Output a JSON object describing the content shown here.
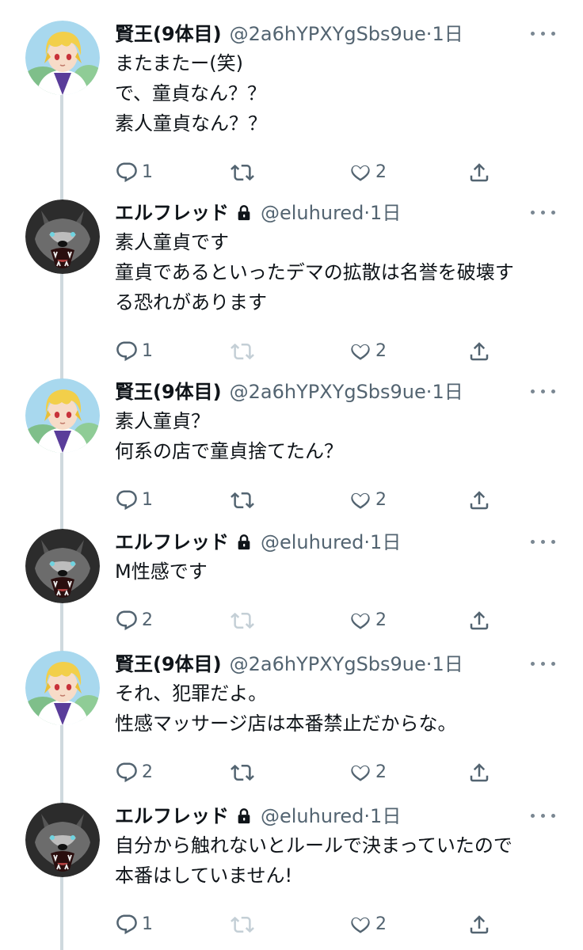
{
  "tweets": [
    {
      "author_type": "kenou",
      "name": "賢王(9体目)",
      "handle": "@2a6hYPXYgSbs9ue",
      "time": "1日",
      "lines": [
        "またまたー(笑)",
        "で、童貞なん？？",
        "素人童貞なん？？"
      ],
      "reply_count": "1",
      "like_count": "2",
      "retweet_active": true,
      "locked": false
    },
    {
      "author_type": "wolf",
      "name": "エルフレッド",
      "handle": "@eluhured",
      "time": "1日",
      "lines": [
        "素人童貞です",
        "童貞であるといったデマの拡散は名誉を破壊す",
        "る恐れがあります"
      ],
      "reply_count": "1",
      "like_count": "2",
      "retweet_active": false,
      "locked": true
    },
    {
      "author_type": "kenou",
      "name": "賢王(9体目)",
      "handle": "@2a6hYPXYgSbs9ue",
      "time": "1日",
      "lines": [
        "素人童貞？",
        "何系の店で童貞捨てたん？"
      ],
      "reply_count": "1",
      "like_count": "2",
      "retweet_active": true,
      "locked": false
    },
    {
      "author_type": "wolf",
      "name": "エルフレッド",
      "handle": "@eluhured",
      "time": "1日",
      "lines": [
        "M性感です"
      ],
      "reply_count": "2",
      "like_count": "2",
      "retweet_active": false,
      "locked": true
    },
    {
      "author_type": "kenou",
      "name": "賢王(9体目)",
      "handle": "@2a6hYPXYgSbs9ue",
      "time": "1日",
      "lines": [
        "それ、犯罪だよ。",
        "性感マッサージ店は本番禁止だからな。"
      ],
      "reply_count": "2",
      "like_count": "2",
      "retweet_active": true,
      "locked": false
    },
    {
      "author_type": "wolf",
      "name": "エルフレッド",
      "handle": "@eluhured",
      "time": "1日",
      "lines": [
        "自分から触れないとルールで決まっていたので",
        "本番はしていません!"
      ],
      "reply_count": "1",
      "like_count": "2",
      "retweet_active": false,
      "locked": true
    }
  ],
  "icons": {
    "reply": "reply-icon",
    "retweet": "retweet-icon",
    "like": "heart-icon",
    "share": "share-icon",
    "lock": "lock-icon",
    "more": "more-icon"
  },
  "colors": {
    "text": "#0f1419",
    "secondary": "#536471",
    "icon": "#536471",
    "icon_disabled": "#c4cfd6",
    "thread_line": "#cfd9de"
  }
}
